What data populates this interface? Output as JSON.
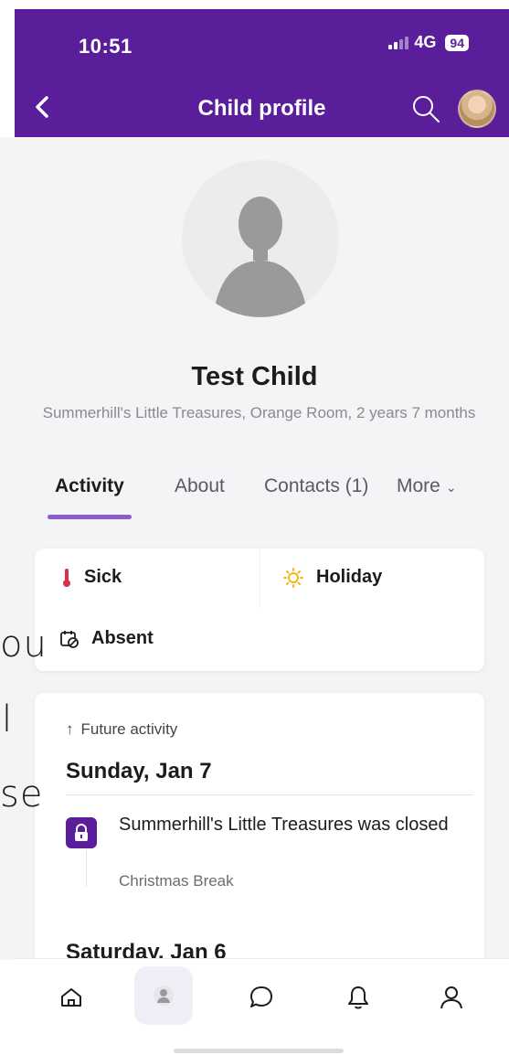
{
  "status_bar": {
    "time": "10:51",
    "network": "4G",
    "battery": "94"
  },
  "header": {
    "title": "Child profile"
  },
  "icons": {
    "back": "back-chevron-icon",
    "search": "search-icon",
    "user_avatar": "user-avatar",
    "profile_placeholder": "person-placeholder-icon"
  },
  "child": {
    "name": "Test Child",
    "subtitle": "Summerhill's Little Treasures, Orange Room, 2 years 7 months"
  },
  "tabs": [
    {
      "label": "Activity",
      "active": true
    },
    {
      "label": "About",
      "active": false
    },
    {
      "label": "Contacts (1)",
      "active": false
    },
    {
      "label": "More",
      "active": false
    }
  ],
  "status_options": {
    "sick": "Sick",
    "holiday": "Holiday",
    "absent": "Absent"
  },
  "activity": {
    "future_label": "Future activity",
    "days": [
      {
        "date": "Sunday, Jan 7",
        "events": [
          {
            "title": "Summerhill's Little Treasures was closed",
            "subtitle": "Christmas Break",
            "icon": "lock-icon"
          }
        ]
      },
      {
        "date": "Saturday, Jan 6",
        "events": []
      }
    ]
  },
  "overlay_fragments": [
    "ou",
    "l",
    "se"
  ],
  "bottom_nav": [
    {
      "name": "home",
      "icon": "home-icon"
    },
    {
      "name": "child",
      "icon": "child-avatar-icon",
      "active": true
    },
    {
      "name": "messages",
      "icon": "chat-bubble-icon"
    },
    {
      "name": "notifications",
      "icon": "bell-icon"
    },
    {
      "name": "profile",
      "icon": "person-icon"
    }
  ],
  "colors": {
    "brand_purple": "#5a1e9a",
    "tab_underline": "#8a5cd0",
    "sick_red": "#d9304a",
    "holiday_sun": "#f2b81a"
  }
}
